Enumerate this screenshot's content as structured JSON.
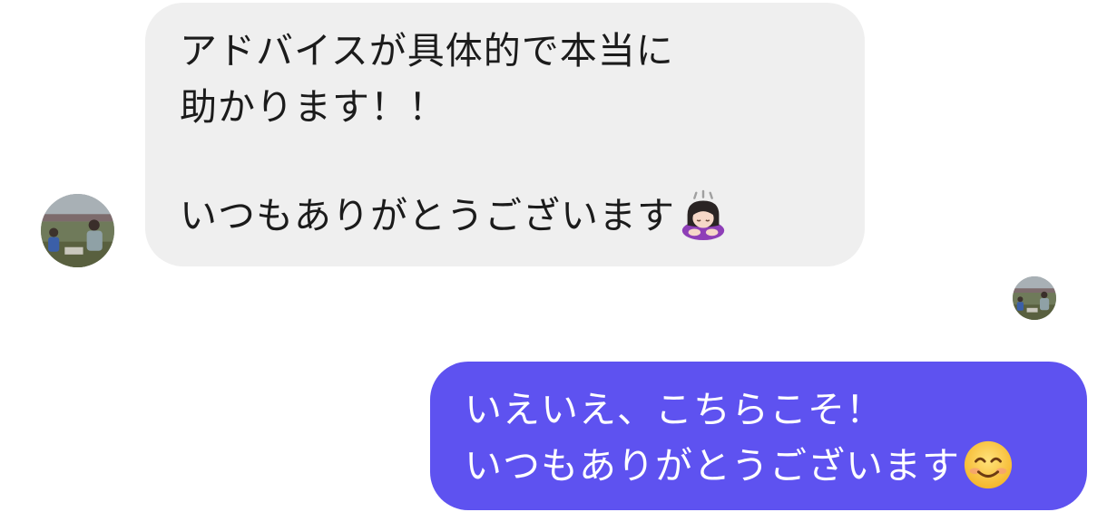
{
  "conversation": {
    "incoming": {
      "lines": [
        "アドバイスが具体的で本当に",
        "助かります！！",
        "",
        "いつもありがとうございます"
      ],
      "emoji": "bowing-woman-icon",
      "avatar": "family-photo-avatar",
      "bubble_color": "#efefef",
      "text_color": "#1b1b1b"
    },
    "outgoing": {
      "lines": [
        "いえいえ、こちらこそ！",
        "いつもありがとうございます"
      ],
      "emoji": "smiling-face-icon",
      "avatar": "family-photo-avatar",
      "bubble_color": "#5e52f0",
      "text_color": "#ffffff"
    }
  }
}
